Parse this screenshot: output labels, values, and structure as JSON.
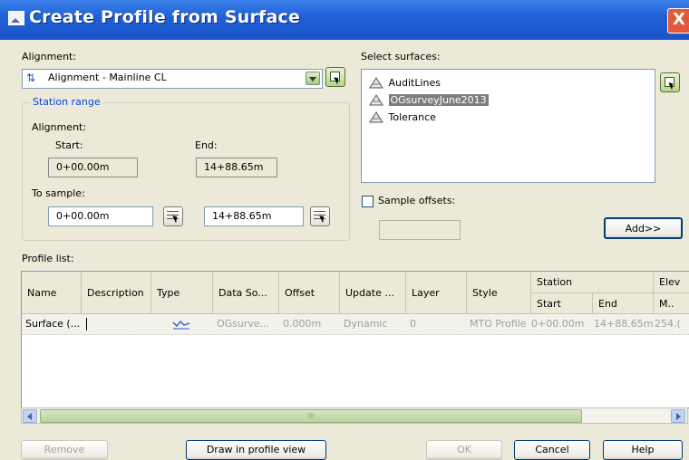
{
  "window": {
    "title": "Create Profile from Surface",
    "close_glyph": "X"
  },
  "alignment": {
    "label": "Alignment:",
    "selected": "Alignment - Mainline CL",
    "station_range": {
      "legend": "Station range",
      "alignment_label": "Alignment:",
      "start_label": "Start:",
      "start_value": "0+00.00m",
      "end_label": "End:",
      "end_value": "14+88.65m",
      "to_sample_label": "To sample:",
      "sample_start": "0+00.00m",
      "sample_end": "14+88.65m"
    }
  },
  "surfaces": {
    "label": "Select surfaces:",
    "items": [
      {
        "name": "AuditLines",
        "selected": false
      },
      {
        "name": "OGsurveyJune2013",
        "selected": true
      },
      {
        "name": "Tolerance",
        "selected": false
      }
    ],
    "sample_offsets_label": "Sample offsets:",
    "sample_offsets_checked": false,
    "add_button": "Add>>"
  },
  "profile_list": {
    "label": "Profile list:",
    "headers": {
      "name": "Name",
      "description": "Description",
      "type": "Type",
      "data_source": "Data So...",
      "offset": "Offset",
      "update": "Update ...",
      "layer": "Layer",
      "style": "Style",
      "station": "Station",
      "station_start": "Start",
      "station_end": "End",
      "elevation": "Elev",
      "elevation_min": "M.."
    },
    "rows": [
      {
        "name": "Surface (...",
        "description": "",
        "type_icon": "profile-line-icon",
        "data_source": "OGsurve...",
        "offset": "0.000m",
        "update": "Dynamic",
        "layer": "0",
        "style": "MTO Profile",
        "station_start": "0+00.00m",
        "station_end": "14+88.65m",
        "elevation_min": "254.("
      }
    ],
    "scroll_grip": "III"
  },
  "buttons": {
    "remove": "Remove",
    "draw": "Draw in profile view",
    "ok": "OK",
    "cancel": "Cancel",
    "help": "Help"
  },
  "colors": {
    "title_bar": "#1f5fd6",
    "dialog_bg": "#ece9d8",
    "group_legend": "#0046d5",
    "selection": "#7d7d7d",
    "close_button": "#e15b3a"
  }
}
